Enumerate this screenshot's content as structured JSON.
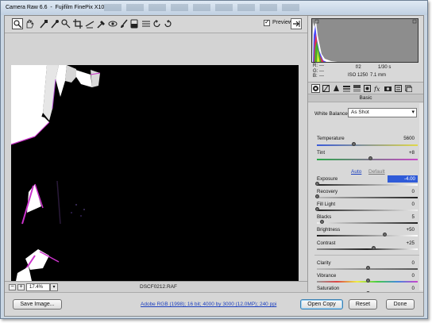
{
  "window": {
    "app_title": "Camera Raw 6.6",
    "separator": "-",
    "camera_model": "Fujifilm FinePix X10"
  },
  "toolbar": {
    "tools": [
      "zoom-icon",
      "hand-icon",
      "white-balance-icon",
      "color-sampler-icon",
      "targeted-adjustment-icon",
      "crop-icon",
      "straighten-icon",
      "spot-removal-icon",
      "red-eye-icon",
      "adjustment-brush-icon",
      "graduated-filter-icon",
      "preferences-icon",
      "rotate-ccw-icon",
      "rotate-cw-icon"
    ],
    "preview_label": "Preview",
    "preview_checked": true
  },
  "info": {
    "r_label": "R:",
    "g_label": "G:",
    "b_label": "B:",
    "r_value": "---",
    "g_value": "---",
    "b_value": "---",
    "aperture": "f/2",
    "shutter": "1/30 s",
    "iso": "ISO 1250",
    "focal_length": "7.1 mm"
  },
  "panel": {
    "section_title": "Basic",
    "white_balance_label": "White Balance:",
    "white_balance_value": "As Shot",
    "auto_label": "Auto",
    "default_label": "Default"
  },
  "sliders": {
    "temperature": {
      "label": "Temperature",
      "value": "5600",
      "level": 0.36
    },
    "tint": {
      "label": "Tint",
      "value": "+8",
      "level": 0.53
    },
    "exposure": {
      "label": "Exposure",
      "value": "-4.00",
      "level": 0.0
    },
    "recovery": {
      "label": "Recovery",
      "value": "0",
      "level": 0.0
    },
    "fill_light": {
      "label": "Fill Light",
      "value": "0",
      "level": 0.0
    },
    "blacks": {
      "label": "Blacks",
      "value": "5",
      "level": 0.05
    },
    "brightness": {
      "label": "Brightness",
      "value": "+50",
      "level": 0.67
    },
    "contrast": {
      "label": "Contrast",
      "value": "+25",
      "level": 0.56
    },
    "clarity": {
      "label": "Clarity",
      "value": "0",
      "level": 0.5
    },
    "vibrance": {
      "label": "Vibrance",
      "value": "0",
      "level": 0.5
    },
    "saturation": {
      "label": "Saturation",
      "value": "0",
      "level": 0.5
    }
  },
  "status": {
    "zoom_value": "17.4%",
    "filename": "DSCF0212.RAF"
  },
  "bottom": {
    "save_label": "Save Image...",
    "workflow_text": "Adobe RGB (1998); 16 bit; 4000 by 3000 (12.0MP); 240 ppi",
    "open_label": "Open Copy",
    "reset_label": "Reset",
    "done_label": "Done"
  }
}
